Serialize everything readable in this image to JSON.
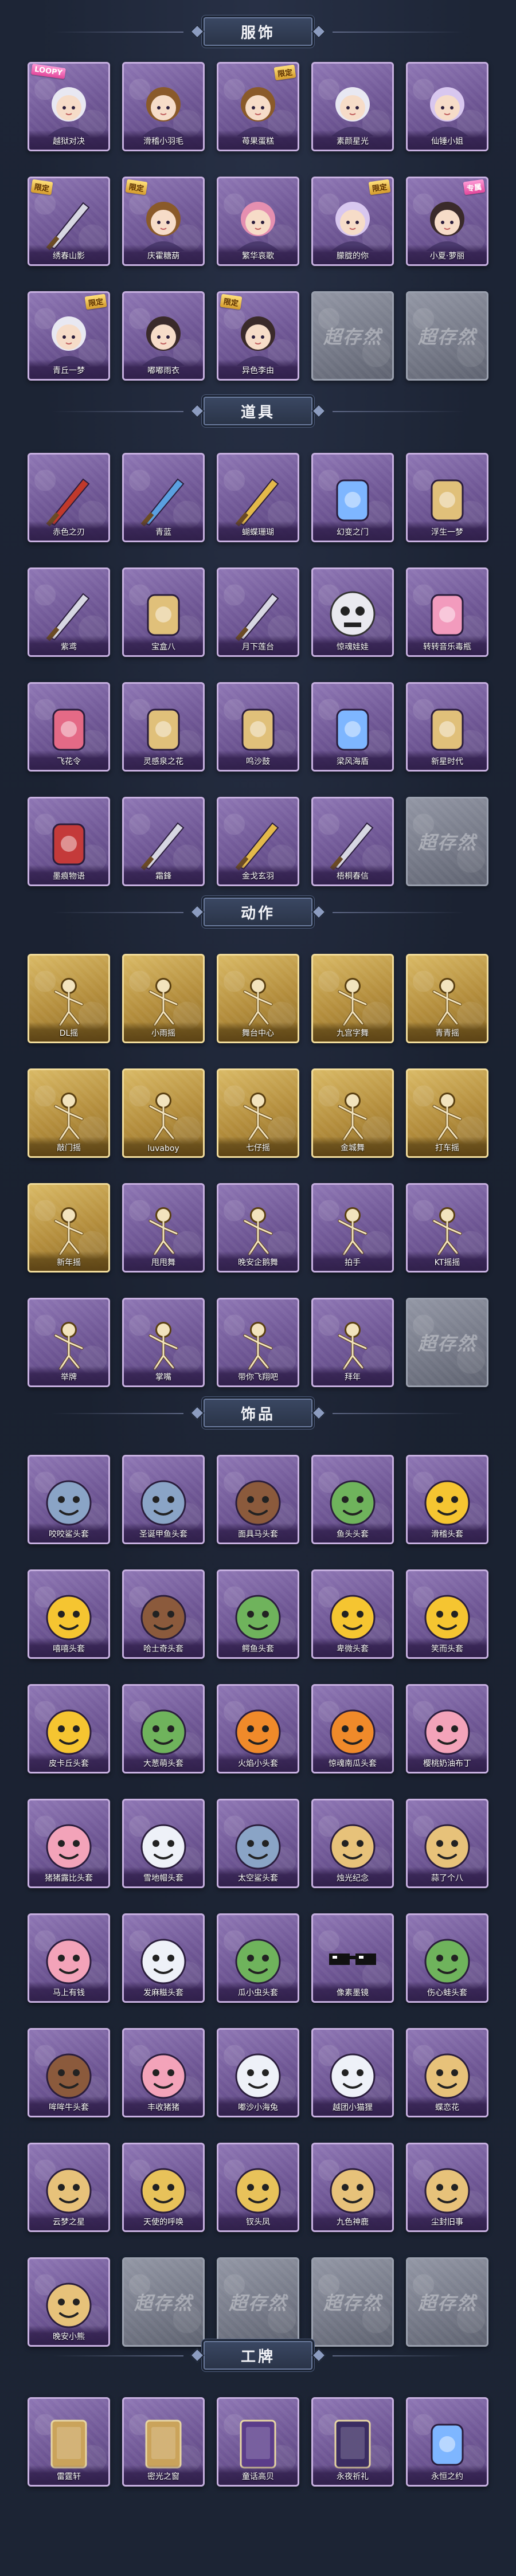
{
  "sections": [
    {
      "key": "costumes",
      "title": "服饰",
      "rows": 3,
      "items": [
        {
          "label": "越狱对决",
          "style": "purple",
          "icon": "girl-clown-icon",
          "tag": "LOOPY",
          "tag_style": "pink",
          "tag_pos": "left"
        },
        {
          "label": "滑稽小羽毛",
          "style": "purple",
          "icon": "feather-mask-icon",
          "tag": "",
          "tag_style": "",
          "tag_pos": ""
        },
        {
          "label": "苺果蛋糕",
          "style": "purple",
          "icon": "cake-hat-girl-icon",
          "tag": "限定",
          "tag_style": "gold",
          "tag_pos": ""
        },
        {
          "label": "素颜星光",
          "style": "purple",
          "icon": "silver-hair-girl-icon",
          "tag": "",
          "tag_style": "",
          "tag_pos": ""
        },
        {
          "label": "仙锤小姐",
          "style": "purple",
          "icon": "fairy-girl-icon",
          "tag": "",
          "tag_style": "",
          "tag_pos": ""
        },
        {
          "label": "绣春山影",
          "style": "purple",
          "icon": "ancient-swordsman-icon",
          "tag": "限定",
          "tag_style": "gold",
          "tag_pos": "left"
        },
        {
          "label": "庆霍糖葫",
          "style": "purple",
          "icon": "festive-boy-icon",
          "tag": "限定",
          "tag_style": "gold",
          "tag_pos": "left"
        },
        {
          "label": "繁华哀歌",
          "style": "purple",
          "icon": "pink-hair-girl-icon",
          "tag": "",
          "tag_style": "",
          "tag_pos": ""
        },
        {
          "label": "朦胧的你",
          "style": "purple",
          "icon": "witch-hat-girl-icon",
          "tag": "限定",
          "tag_style": "gold",
          "tag_pos": ""
        },
        {
          "label": "小夏·萝丽",
          "style": "purple",
          "icon": "dark-hair-girl-icon",
          "tag": "专属",
          "tag_style": "pink",
          "tag_pos": ""
        },
        {
          "label": "青丘一梦",
          "style": "purple",
          "icon": "fox-girl-icon",
          "tag": "限定",
          "tag_style": "gold",
          "tag_pos": ""
        },
        {
          "label": "嘟嘟雨衣",
          "style": "purple",
          "icon": "raincoat-girl-icon",
          "tag": "",
          "tag_style": "",
          "tag_pos": ""
        },
        {
          "label": "异色李由",
          "style": "purple",
          "icon": "lady-hat-icon",
          "tag": "限定",
          "tag_style": "gold",
          "tag_pos": "left"
        },
        {
          "label": "",
          "style": "grey",
          "icon": "",
          "tag": "",
          "tag_style": "",
          "tag_pos": ""
        },
        {
          "label": "",
          "style": "grey",
          "icon": "",
          "tag": "",
          "tag_style": "",
          "tag_pos": ""
        }
      ]
    },
    {
      "key": "props",
      "title": "道具",
      "rows": 4,
      "items": [
        {
          "label": "赤色之刃",
          "style": "purple",
          "icon": "red-blade-icon"
        },
        {
          "label": "青蓝",
          "style": "purple",
          "icon": "blue-sword-icon"
        },
        {
          "label": "蝴蝶珊瑚",
          "style": "purple",
          "icon": "golden-staff-icon"
        },
        {
          "label": "幻变之门",
          "style": "purple",
          "icon": "magic-mirror-icon"
        },
        {
          "label": "浮生一梦",
          "style": "purple",
          "icon": "hourglass-icon"
        },
        {
          "label": "紫鸢",
          "style": "purple",
          "icon": "pendant-icon"
        },
        {
          "label": "宝盒八",
          "style": "purple",
          "icon": "heart-box-icon"
        },
        {
          "label": "月下莲台",
          "style": "purple",
          "icon": "wand-icon"
        },
        {
          "label": "惊魂娃娃",
          "style": "purple",
          "icon": "skull-ball-icon"
        },
        {
          "label": "转转音乐毒瓶",
          "style": "purple",
          "icon": "pink-bottle-icon"
        },
        {
          "label": "飞花令",
          "style": "purple",
          "icon": "flower-bouquet-icon"
        },
        {
          "label": "灵感泉之花",
          "style": "purple",
          "icon": "flower-vase-icon"
        },
        {
          "label": "鸣沙鼓",
          "style": "purple",
          "icon": "lantern-icon"
        },
        {
          "label": "梁风海盾",
          "style": "purple",
          "icon": "blue-gadget-icon"
        },
        {
          "label": "新星时代",
          "style": "purple",
          "icon": "revolver-icon"
        },
        {
          "label": "墨痕物语",
          "style": "purple",
          "icon": "first-aid-kit-icon"
        },
        {
          "label": "霜鋒",
          "style": "purple",
          "icon": "dagger-icon"
        },
        {
          "label": "金戈玄羽",
          "style": "purple",
          "icon": "golden-spear-icon"
        },
        {
          "label": "梧桐春信",
          "style": "purple",
          "icon": "feather-pen-icon"
        },
        {
          "label": "",
          "style": "grey",
          "icon": ""
        }
      ]
    },
    {
      "key": "actions",
      "title": "动作",
      "rows": 4,
      "items": [
        {
          "label": "DL摇",
          "style": "gold",
          "icon": "dance-pose-icon"
        },
        {
          "label": "小雨摇",
          "style": "gold",
          "icon": "dance-pose-icon"
        },
        {
          "label": "舞台中心",
          "style": "gold",
          "icon": "dance-pose-icon"
        },
        {
          "label": "九宫字舞",
          "style": "gold",
          "icon": "dance-pose-icon"
        },
        {
          "label": "青青摇",
          "style": "gold",
          "icon": "dance-pose-icon"
        },
        {
          "label": "敲门摇",
          "style": "gold",
          "icon": "dance-pose-icon"
        },
        {
          "label": "luvaboy",
          "style": "gold",
          "icon": "dance-pose-icon"
        },
        {
          "label": "七仔摇",
          "style": "gold",
          "icon": "dance-pose-icon"
        },
        {
          "label": "金城舞",
          "style": "gold",
          "icon": "dance-pose-icon"
        },
        {
          "label": "打车摇",
          "style": "gold",
          "icon": "dance-pose-icon"
        },
        {
          "label": "新年摇",
          "style": "gold",
          "icon": "dance-pose-icon"
        },
        {
          "label": "甩甩舞",
          "style": "purple",
          "icon": "dance-pose-icon"
        },
        {
          "label": "晚安企鹅舞",
          "style": "purple",
          "icon": "dance-pose-icon"
        },
        {
          "label": "拍手",
          "style": "purple",
          "icon": "dance-pose-icon"
        },
        {
          "label": "KT摇摇",
          "style": "purple",
          "icon": "dance-pose-icon"
        },
        {
          "label": "举牌",
          "style": "purple",
          "icon": "dance-pose-icon"
        },
        {
          "label": "掌嘴",
          "style": "purple",
          "icon": "dance-pose-icon"
        },
        {
          "label": "带你飞翔吧",
          "style": "purple",
          "icon": "dance-pose-icon"
        },
        {
          "label": "拜年",
          "style": "purple",
          "icon": "dance-pose-icon"
        },
        {
          "label": "",
          "style": "grey",
          "icon": ""
        }
      ]
    },
    {
      "key": "accessories",
      "title": "饰品",
      "rows": 8,
      "items": [
        {
          "label": "咬咬鲨头套",
          "style": "purple",
          "icon": "shark-head-icon"
        },
        {
          "label": "圣诞甲鱼头套",
          "style": "purple",
          "icon": "seal-head-icon"
        },
        {
          "label": "面具马头套",
          "style": "purple",
          "icon": "horse-head-icon"
        },
        {
          "label": "鱼头头套",
          "style": "purple",
          "icon": "frog-head-icon"
        },
        {
          "label": "滑稽头套",
          "style": "purple",
          "icon": "smiley-head-icon"
        },
        {
          "label": "嘻嘻头套",
          "style": "purple",
          "icon": "grin-head-icon"
        },
        {
          "label": "哈士奇头套",
          "style": "purple",
          "icon": "dog-head-icon"
        },
        {
          "label": "鳄鱼头套",
          "style": "purple",
          "icon": "crocodile-head-icon"
        },
        {
          "label": "卑微头套",
          "style": "purple",
          "icon": "sad-face-head-icon"
        },
        {
          "label": "笑而头套",
          "style": "purple",
          "icon": "laugh-head-icon"
        },
        {
          "label": "皮卡丘头套",
          "style": "purple",
          "icon": "pikachu-head-icon"
        },
        {
          "label": "大葱萌头套",
          "style": "purple",
          "icon": "onion-head-icon"
        },
        {
          "label": "火焰小头套",
          "style": "purple",
          "icon": "flame-head-icon"
        },
        {
          "label": "惊魂南瓜头套",
          "style": "purple",
          "icon": "pumpkin-head-icon"
        },
        {
          "label": "樱桃奶油布丁",
          "style": "purple",
          "icon": "pudding-head-icon"
        },
        {
          "label": "猪猪露比头套",
          "style": "purple",
          "icon": "pink-pig-head-icon"
        },
        {
          "label": "雪地帽头套",
          "style": "purple",
          "icon": "snow-hat-head-icon"
        },
        {
          "label": "太空鲨头套",
          "style": "purple",
          "icon": "space-shark-head-icon"
        },
        {
          "label": "烛光纪念",
          "style": "purple",
          "icon": "candle-head-icon"
        },
        {
          "label": "蒜了个八",
          "style": "purple",
          "icon": "garlic-head-icon"
        },
        {
          "label": "马上有钱",
          "style": "purple",
          "icon": "money-pig-head-icon"
        },
        {
          "label": "发麻糍头套",
          "style": "purple",
          "icon": "mochi-head-icon"
        },
        {
          "label": "瓜小虫头套",
          "style": "purple",
          "icon": "melon-bug-head-icon"
        },
        {
          "label": "像素墨镜",
          "style": "purple",
          "icon": "pixel-glasses-icon"
        },
        {
          "label": "伤心蛙头套",
          "style": "purple",
          "icon": "pepe-frog-head-icon"
        },
        {
          "label": "哞哞牛头套",
          "style": "purple",
          "icon": "cow-head-icon"
        },
        {
          "label": "丰收猪猪",
          "style": "purple",
          "icon": "harvest-pig-head-icon"
        },
        {
          "label": "嘟沙小海兔",
          "style": "purple",
          "icon": "blue-cat-head-icon"
        },
        {
          "label": "越团小猫狸",
          "style": "purple",
          "icon": "white-cat-head-icon"
        },
        {
          "label": "蝶恋花",
          "style": "purple",
          "icon": "butterfly-bell-icon"
        },
        {
          "label": "云梦之星",
          "style": "purple",
          "icon": "unicorn-cloud-icon"
        },
        {
          "label": "天使的呼唤",
          "style": "purple",
          "icon": "angel-crown-icon"
        },
        {
          "label": "钗头凤",
          "style": "purple",
          "icon": "phoenix-crown-icon"
        },
        {
          "label": "九色神鹿",
          "style": "purple",
          "icon": "deer-antler-icon"
        },
        {
          "label": "尘封旧事",
          "style": "purple",
          "icon": "little-doll-icon"
        },
        {
          "label": "晚安小熊",
          "style": "purple",
          "icon": "bear-charm-icon"
        },
        {
          "label": "",
          "style": "grey",
          "icon": ""
        },
        {
          "label": "",
          "style": "grey",
          "icon": ""
        },
        {
          "label": "",
          "style": "grey",
          "icon": ""
        },
        {
          "label": "",
          "style": "grey",
          "icon": ""
        }
      ]
    },
    {
      "key": "badges",
      "title": "工牌",
      "rows": 1,
      "items": [
        {
          "label": "雷霆轩",
          "style": "purple",
          "icon": "badge-card-icon"
        },
        {
          "label": "密光之窗",
          "style": "purple",
          "icon": "badge-frame-icon"
        },
        {
          "label": "童话高贝",
          "style": "purple",
          "icon": "badge-door-icon"
        },
        {
          "label": "永夜祈礼",
          "style": "purple",
          "icon": "badge-dark-icon"
        },
        {
          "label": "永恒之约",
          "style": "purple",
          "icon": "badge-mirror-icon"
        }
      ]
    }
  ],
  "placeholder_text": "超存然",
  "colors": {
    "background": "#1b2332",
    "card_purple": "#7a62a2",
    "card_gold": "#c5a24f",
    "card_grey": "#7e8290"
  }
}
